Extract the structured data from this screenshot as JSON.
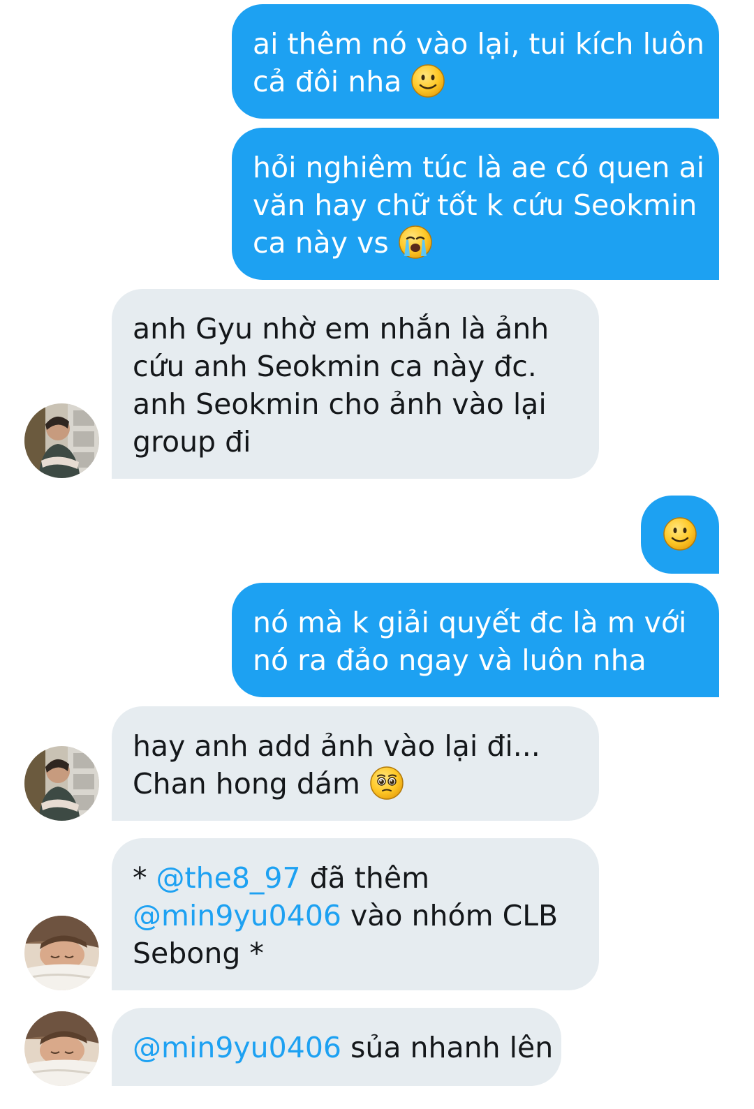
{
  "conversation": {
    "messages": [
      {
        "id": "m1",
        "direction": "sent",
        "lines": [
          "ai thêm nó vào lại, tui kích luôn",
          "cả đôi nha"
        ],
        "emoji": "slightly-smiling-face"
      },
      {
        "id": "m2",
        "direction": "sent",
        "lines": [
          "hỏi nghiêm túc là ae có quen ai",
          "văn hay chữ tốt k cứu Seokmin",
          "ca này vs"
        ],
        "emoji": "loudly-crying-face"
      },
      {
        "id": "m3",
        "direction": "received",
        "avatar": "avatar-photo-man-by-window",
        "lines": [
          "anh Gyu nhờ em nhắn là ảnh",
          "cứu anh Seokmin ca này đc.",
          "anh Seokmin cho ảnh vào lại",
          "group đi"
        ]
      },
      {
        "id": "m4",
        "direction": "sent",
        "emoji": "slightly-smiling-face"
      },
      {
        "id": "m5",
        "direction": "sent",
        "lines": [
          "nó mà k giải quyết đc là m với",
          "nó ra đảo ngay và luôn nha"
        ]
      },
      {
        "id": "m6",
        "direction": "received",
        "avatar": "avatar-photo-man-by-window",
        "lines": [
          "hay anh add ảnh vào lại đi...",
          "Chan hong dám"
        ],
        "emoji": "pleading-face"
      },
      {
        "id": "m7",
        "direction": "received",
        "avatar": "avatar-photo-sleeping",
        "line1_prefix": "* ",
        "line1_mention": "@the8_97",
        "line1_suffix": " đã thêm",
        "line2_mention": "@min9yu0406",
        "line2_suffix": " vào nhóm CLB",
        "line3": "Sebong *"
      },
      {
        "id": "m8",
        "direction": "received",
        "avatar": "avatar-photo-sleeping",
        "mention": "@min9yu0406",
        "text": " sủa nhanh lên"
      }
    ]
  },
  "colors": {
    "sent_bubble": "#1da1f2",
    "received_bubble": "#e6ecf0",
    "mention": "#1da1f2",
    "received_text": "#14171a",
    "sent_text": "#ffffff"
  }
}
